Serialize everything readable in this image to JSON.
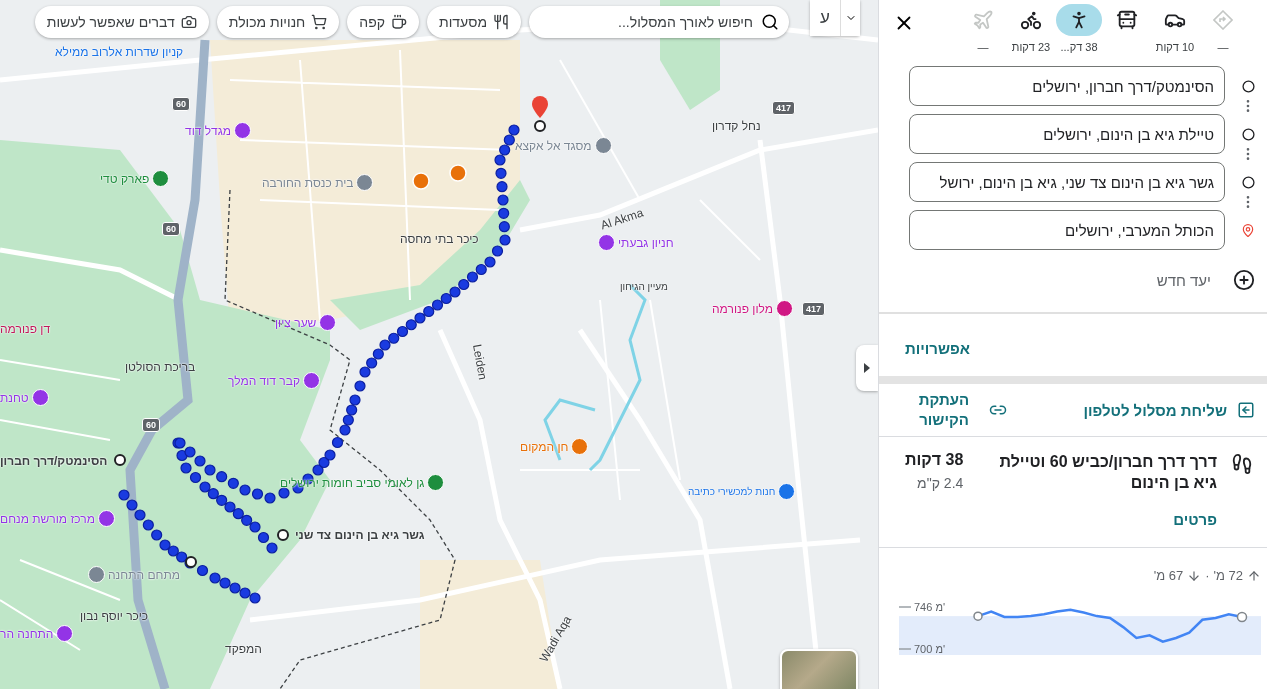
{
  "map": {
    "language_button": "ע",
    "search": {
      "placeholder": "חיפוש לאורך המסלול..."
    },
    "chips": [
      {
        "kind": "restaurants",
        "label": "מסעדות"
      },
      {
        "kind": "coffee",
        "label": "קפה"
      },
      {
        "kind": "grocery",
        "label": "חנויות מכולת"
      },
      {
        "kind": "things",
        "label": "דברים שאפשר לעשות"
      }
    ],
    "road_shields": [
      "60",
      "60",
      "60",
      "417",
      "417"
    ],
    "places": [
      {
        "name": "קניון שדרות אלרוב ממילא",
        "color": "#1a73e8"
      },
      {
        "name": "מגדל דוד",
        "color": "#9334e6"
      },
      {
        "name": "פארק טדי",
        "color": "#1e8e3e"
      },
      {
        "name": "בית כנסת החורבה",
        "color": "#7b8794"
      },
      {
        "name": "מסגד אל אקצא",
        "color": "#7b8794"
      },
      {
        "name": "נחל קדרון"
      },
      {
        "name": "כיכר בתי מחסה"
      },
      {
        "name": "Al Akma"
      },
      {
        "name": "חניון גבעתי",
        "color": "#9334e6"
      },
      {
        "name": "שער ציון",
        "color": "#9334e6"
      },
      {
        "name": "דן פנורמה",
        "color": "#c2185b"
      },
      {
        "name": "בריכת הסולטן"
      },
      {
        "name": "קבר דוד המלך",
        "color": "#9334e6"
      },
      {
        "name": "מלון פנורמה",
        "color": "#d01884"
      },
      {
        "name": "חן המקום",
        "color": "#e8710a"
      },
      {
        "name": "גן לאומי סביב חומות ירושלים",
        "color": "#1e8e3e"
      },
      {
        "name": "חנות למכשירי כתיבה",
        "color": "#1a73e8"
      },
      {
        "name": "הסינמטק/דרך חברון"
      },
      {
        "name": "מרכז מורשת מנחם",
        "color": "#9334e6"
      },
      {
        "name": "גשר גיא בן הינום צד שני"
      },
      {
        "name": "מתחם התחנה",
        "color": "#7b8794"
      },
      {
        "name": "התחנה הר",
        "color": "#9334e6"
      },
      {
        "name": "כיכר יוסף נבון"
      },
      {
        "name": "Wadi Aqa"
      },
      {
        "name": "Leiden"
      },
      {
        "name": "מעיין הגיחון"
      },
      {
        "name": "המפקד"
      },
      {
        "name": "טחנת",
        "color": "#9334e6"
      }
    ]
  },
  "panel": {
    "modes": [
      {
        "kind": "best",
        "time": "—",
        "selected": false,
        "disabled": true
      },
      {
        "kind": "car",
        "time": "10 דקות",
        "selected": false,
        "disabled": false
      },
      {
        "kind": "transit",
        "selected": false,
        "disabled": false
      },
      {
        "kind": "walk",
        "time": "38 דק...",
        "selected": true,
        "disabled": false
      },
      {
        "kind": "bike",
        "time": "23 דקות",
        "selected": false,
        "disabled": false
      },
      {
        "kind": "flight",
        "time": "—",
        "selected": false,
        "disabled": true
      }
    ],
    "waypoints": [
      {
        "kind": "stop",
        "value": "הסינמטק/דרך חברון, ירושלים"
      },
      {
        "kind": "stop",
        "value": "טיילת גיא בן הינום, ירושלים"
      },
      {
        "kind": "stop",
        "value": "גשר גיא בן הינום צד שני, גיא בן הינום, ירושל"
      },
      {
        "kind": "destination",
        "value": "הכותל המערבי, ירושלים"
      }
    ],
    "add_destination": "יעד חדש",
    "options": "אפשרויות",
    "send_to_phone": "שליחת מסלול לטלפון",
    "copy_link": "העתקת הקישור",
    "route": {
      "title": "דרך דרך חברון/כביש 60 וטיילת גיא בן הינום",
      "duration": "38 דקות",
      "distance": "2.4 ק\"מ",
      "details": "פרטים"
    },
    "elevation": {
      "ascent": "72 מ'",
      "descent": "67 מ'",
      "separator": "·",
      "chart_data": {
        "type": "line",
        "categories": [
          null,
          null,
          null,
          null,
          null,
          null,
          null,
          null,
          null,
          null,
          null,
          null,
          null,
          null,
          null,
          null,
          null,
          null,
          null,
          null,
          null
        ],
        "series": [
          {
            "color": "#4285f4",
            "values": [
              736,
              741,
              735,
              735,
              736,
              738,
              741,
              743,
              740,
              736,
              734,
              724,
              712,
              715,
              708,
              712,
              718,
              732,
              734,
              738,
              735
            ]
          }
        ],
        "ylim": [
          700,
          746
        ],
        "yticks": [
          {
            "value": 746,
            "label": "746 מ'"
          },
          {
            "value": 700,
            "label": "700 מ'"
          }
        ]
      }
    }
  }
}
